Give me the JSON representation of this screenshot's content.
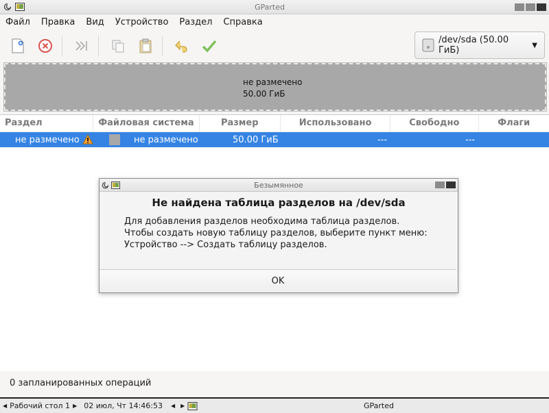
{
  "window": {
    "title": "GParted"
  },
  "menu": [
    "Файл",
    "Правка",
    "Вид",
    "Устройство",
    "Раздел",
    "Справка"
  ],
  "device_selector": {
    "label": "/dev/sda (50.00 ГиБ)"
  },
  "disk_map": {
    "label": "не размечено",
    "size": "50.00 ГиБ"
  },
  "table": {
    "columns": [
      "Раздел",
      "Файловая система",
      "Размер",
      "Использовано",
      "Свободно",
      "Флаги"
    ],
    "rows": [
      {
        "partition": "не размечено",
        "filesystem": "не размечено",
        "size": "50.00 ГиБ",
        "used": "---",
        "free": "---",
        "flags": ""
      }
    ]
  },
  "dialog": {
    "title": "Безымянное",
    "heading": "Не найдена таблица разделов на /dev/sda",
    "lines": [
      "Для добавления разделов необходима таблица разделов.",
      "Чтобы создать новую таблицу разделов, выберите пункт меню:",
      "Устройство --> Создать таблицу разделов."
    ],
    "ok_label": "OK"
  },
  "status": {
    "pending": "0 запланированных операций"
  },
  "taskbar": {
    "desktop": "Рабочий стол 1",
    "datetime": "02 июл, Чт 14:46:53",
    "task": "GParted"
  },
  "colors": {
    "selection": "#3584e4",
    "unallocated": "#a8a8a8"
  }
}
